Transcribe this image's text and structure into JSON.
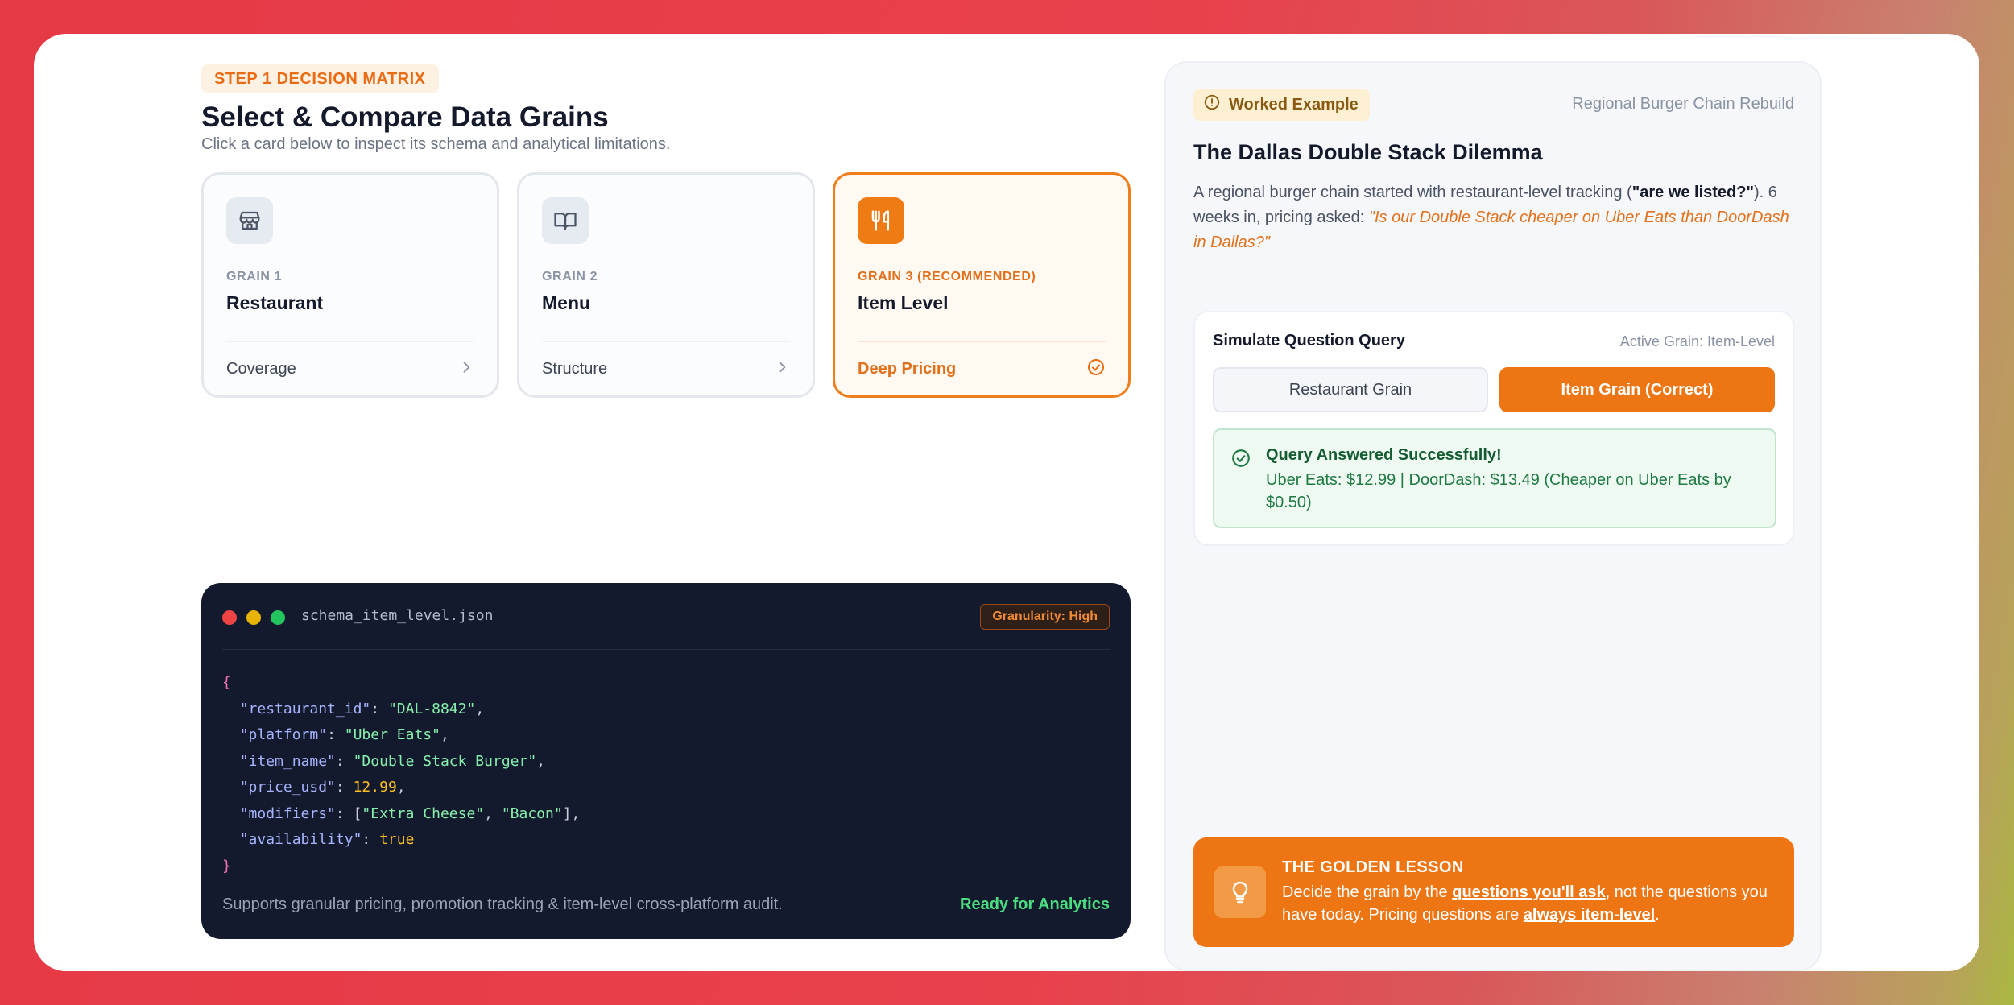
{
  "header": {
    "step_label": "STEP 1 DECISION MATRIX",
    "title": "Select & Compare Data Grains",
    "subtitle": "Click a card below to inspect its schema and analytical limitations."
  },
  "cards": [
    {
      "grain": "GRAIN 1",
      "name": "Restaurant",
      "foot": "Coverage",
      "icon": "store-icon",
      "selected": false
    },
    {
      "grain": "GRAIN 2",
      "name": "Menu",
      "foot": "Structure",
      "icon": "book-icon",
      "selected": false
    },
    {
      "grain": "GRAIN 3 (RECOMMENDED)",
      "name": "Item Level",
      "foot": "Deep Pricing",
      "icon": "utensils-icon",
      "selected": true
    }
  ],
  "code_panel": {
    "filename": "schema_item_level.json",
    "badge": "Granularity: High",
    "lines": {
      "open": "{",
      "k1": "\"restaurant_id\"",
      "v1": "\"DAL-8842\"",
      "k2": "\"platform\"",
      "v2": "\"Uber Eats\"",
      "k3": "\"item_name\"",
      "v3": "\"Double Stack Burger\"",
      "k4": "\"price_usd\"",
      "v4": "12.99",
      "k5": "\"modifiers\"",
      "v5a": "\"Extra Cheese\"",
      "v5b": "\"Bacon\"",
      "k6": "\"availability\"",
      "v6": "true",
      "close": "}"
    },
    "footer_text": "Supports granular pricing, promotion tracking & item-level cross-platform audit.",
    "footer_status": "Ready for Analytics"
  },
  "worked_example": {
    "badge": "Worked Example",
    "context": "Regional Burger Chain Rebuild",
    "title": "The Dallas Double Stack Dilemma",
    "desc_part1": "A regional burger chain started with restaurant-level tracking (",
    "desc_strong": "\"are we listed?\"",
    "desc_part2": "). 6 weeks in, pricing asked: ",
    "desc_quote": "\"Is our Double Stack cheaper on Uber Eats than DoorDash in Dallas?\""
  },
  "simulator": {
    "title": "Simulate Question Query",
    "active": "Active Grain: Item-Level",
    "btn_restaurant": "Restaurant Grain",
    "btn_item": "Item Grain (Correct)",
    "success_title": "Query Answered Successfully!",
    "success_detail": "Uber Eats: $12.99 | DoorDash: $13.49 (Cheaper on Uber Eats by $0.50)"
  },
  "lesson": {
    "title": "THE GOLDEN LESSON",
    "t1": "Decide the grain by the ",
    "u1": "questions you'll ask",
    "t2": ", not the questions you have today. Pricing questions are ",
    "u2": "always item-level",
    "t3": "."
  },
  "colors": {
    "accent": "#ee7513",
    "background": "#e63946",
    "success": "#1f7a44",
    "code_bg": "#141a2e"
  }
}
